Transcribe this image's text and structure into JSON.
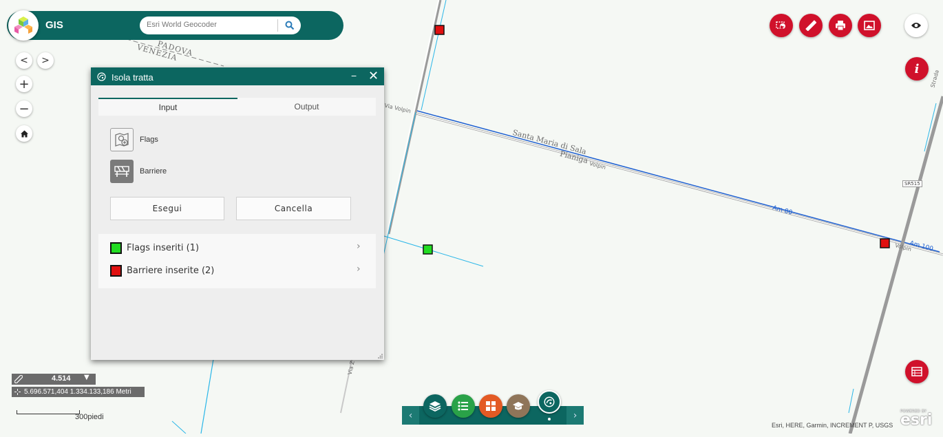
{
  "header": {
    "app_title": "GIS"
  },
  "search": {
    "placeholder": "Esri World Geocoder",
    "value": ""
  },
  "map": {
    "labels": [
      "PADOVA",
      "VENEZIA",
      "Santa Maria di Sala",
      "Pianiga",
      "Via Volpin",
      "Volpin",
      "Volpin",
      "Via Z",
      "Strada",
      "SR515"
    ],
    "road_numbers": [
      "Am 80",
      "Am 100"
    ]
  },
  "panel": {
    "title": "Isola tratta",
    "tabs": [
      "Input",
      "Output"
    ],
    "tools": [
      {
        "label": "Flags",
        "icon": "flag-map-icon"
      },
      {
        "label": "Barriere",
        "icon": "barrier-icon"
      }
    ],
    "buttons": {
      "run": "Esegui",
      "clear": "Cancella"
    },
    "results": [
      {
        "label": "Flags inseriti (1)",
        "color": "#22dd22"
      },
      {
        "label": "Barriere inserite (2)",
        "color": "#e01010"
      }
    ]
  },
  "status": {
    "scale": "4.514",
    "coordinates": "5.696.571,404 1.334.133,186 Metri",
    "scalebar_label": "300piedi"
  },
  "attribution": "Esri, HERE, Garmin, INCREMENT P, USGS",
  "esri_logo": {
    "powered_by": "POWERED BY",
    "brand": "esri"
  },
  "colors": {
    "primary": "#0c6660",
    "tool_red": "#d0112b",
    "flag": "#22dd22",
    "barrier": "#e01010"
  }
}
